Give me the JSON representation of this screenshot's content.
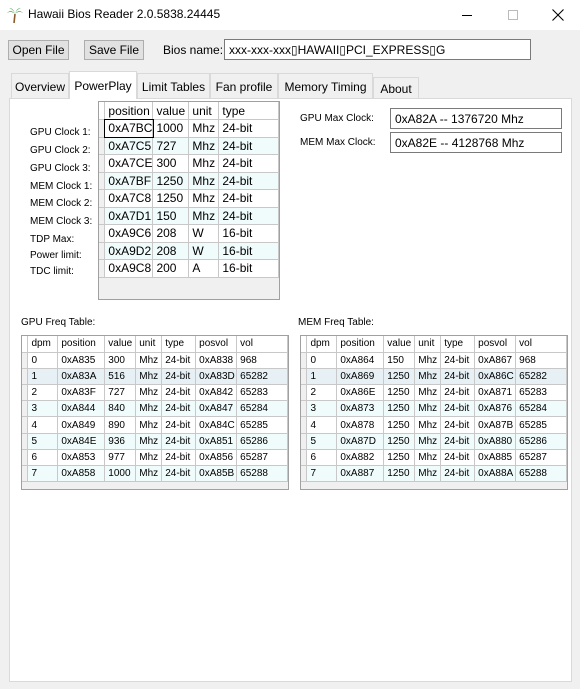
{
  "window": {
    "title": "Hawaii Bios Reader 2.0.5838.24445",
    "icon": "palm-tree-icon"
  },
  "toolbar": {
    "open_label": "Open File",
    "save_label": "Save File",
    "bios_name_label": "Bios name:",
    "bios_name_value": "xxx-xxx-xxx▯HAWAII▯PCI_EXPRESS▯G"
  },
  "tabs": [
    "Overview",
    "PowerPlay",
    "Limit Tables",
    "Fan profile",
    "Memory Timing",
    "About"
  ],
  "powerplay": {
    "row_labels": [
      "GPU Clock 1:",
      "GPU Clock 2:",
      "GPU Clock 3:",
      "MEM Clock 1:",
      "MEM Clock 2:",
      "MEM Clock 3:",
      "TDP Max:",
      "Power limit:",
      "TDC limit:"
    ],
    "columns": [
      "position",
      "value",
      "unit",
      "type"
    ],
    "rows": [
      [
        "0xA7BC",
        "1000",
        "Mhz",
        "24-bit"
      ],
      [
        "0xA7C5",
        "727",
        "Mhz",
        "24-bit"
      ],
      [
        "0xA7CE",
        "300",
        "Mhz",
        "24-bit"
      ],
      [
        "0xA7BF",
        "1250",
        "Mhz",
        "24-bit"
      ],
      [
        "0xA7C8",
        "1250",
        "Mhz",
        "24-bit"
      ],
      [
        "0xA7D1",
        "150",
        "Mhz",
        "24-bit"
      ],
      [
        "0xA9C6",
        "208",
        "W",
        "16-bit"
      ],
      [
        "0xA9D2",
        "208",
        "W",
        "16-bit"
      ],
      [
        "0xA9C8",
        "200",
        "A",
        "16-bit"
      ]
    ],
    "gpu_max_label": "GPU Max Clock:",
    "gpu_max_value": "0xA82A -- 1376720 Mhz",
    "mem_max_label": "MEM Max Clock:",
    "mem_max_value": "0xA82E -- 4128768 Mhz"
  },
  "gpu_freq": {
    "label": "GPU Freq Table:",
    "columns": [
      "dpm",
      "position",
      "value",
      "unit",
      "type",
      "posvol",
      "vol"
    ],
    "rows": [
      [
        "0",
        "0xA835",
        "300",
        "Mhz",
        "24-bit",
        "0xA838",
        "968"
      ],
      [
        "1",
        "0xA83A",
        "516",
        "Mhz",
        "24-bit",
        "0xA83D",
        "65282"
      ],
      [
        "2",
        "0xA83F",
        "727",
        "Mhz",
        "24-bit",
        "0xA842",
        "65283"
      ],
      [
        "3",
        "0xA844",
        "840",
        "Mhz",
        "24-bit",
        "0xA847",
        "65284"
      ],
      [
        "4",
        "0xA849",
        "890",
        "Mhz",
        "24-bit",
        "0xA84C",
        "65285"
      ],
      [
        "5",
        "0xA84E",
        "936",
        "Mhz",
        "24-bit",
        "0xA851",
        "65286"
      ],
      [
        "6",
        "0xA853",
        "977",
        "Mhz",
        "24-bit",
        "0xA856",
        "65287"
      ],
      [
        "7",
        "0xA858",
        "1000",
        "Mhz",
        "24-bit",
        "0xA85B",
        "65288"
      ]
    ]
  },
  "mem_freq": {
    "label": "MEM Freq Table:",
    "columns": [
      "dpm",
      "position",
      "value",
      "unit",
      "type",
      "posvol",
      "vol"
    ],
    "rows": [
      [
        "0",
        "0xA864",
        "150",
        "Mhz",
        "24-bit",
        "0xA867",
        "968"
      ],
      [
        "1",
        "0xA869",
        "1250",
        "Mhz",
        "24-bit",
        "0xA86C",
        "65282"
      ],
      [
        "2",
        "0xA86E",
        "1250",
        "Mhz",
        "24-bit",
        "0xA871",
        "65283"
      ],
      [
        "3",
        "0xA873",
        "1250",
        "Mhz",
        "24-bit",
        "0xA876",
        "65284"
      ],
      [
        "4",
        "0xA878",
        "1250",
        "Mhz",
        "24-bit",
        "0xA87B",
        "65285"
      ],
      [
        "5",
        "0xA87D",
        "1250",
        "Mhz",
        "24-bit",
        "0xA880",
        "65286"
      ],
      [
        "6",
        "0xA882",
        "1250",
        "Mhz",
        "24-bit",
        "0xA885",
        "65287"
      ],
      [
        "7",
        "0xA887",
        "1250",
        "Mhz",
        "24-bit",
        "0xA88A",
        "65288"
      ]
    ]
  }
}
